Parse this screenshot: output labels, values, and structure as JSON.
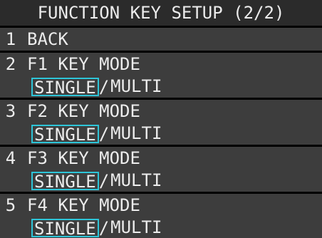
{
  "title": "FUNCTION KEY SETUP (2/2)",
  "colors": {
    "background": "#000000",
    "title_bg": "#2b2b2b",
    "row_bg": "#3d3d3d",
    "text": "#ececec",
    "selection_border": "#2ec5d8"
  },
  "menu": [
    {
      "number": "1",
      "label": "BACK"
    },
    {
      "number": "2",
      "label": "F1 KEY MODE",
      "options": [
        "SINGLE",
        "MULTI"
      ],
      "selected": "SINGLE"
    },
    {
      "number": "3",
      "label": "F2 KEY MODE",
      "options": [
        "SINGLE",
        "MULTI"
      ],
      "selected": "SINGLE"
    },
    {
      "number": "4",
      "label": "F3 KEY MODE",
      "options": [
        "SINGLE",
        "MULTI"
      ],
      "selected": "SINGLE"
    },
    {
      "number": "5",
      "label": "F4 KEY MODE",
      "options": [
        "SINGLE",
        "MULTI"
      ],
      "selected": "SINGLE"
    }
  ],
  "separator": "/"
}
